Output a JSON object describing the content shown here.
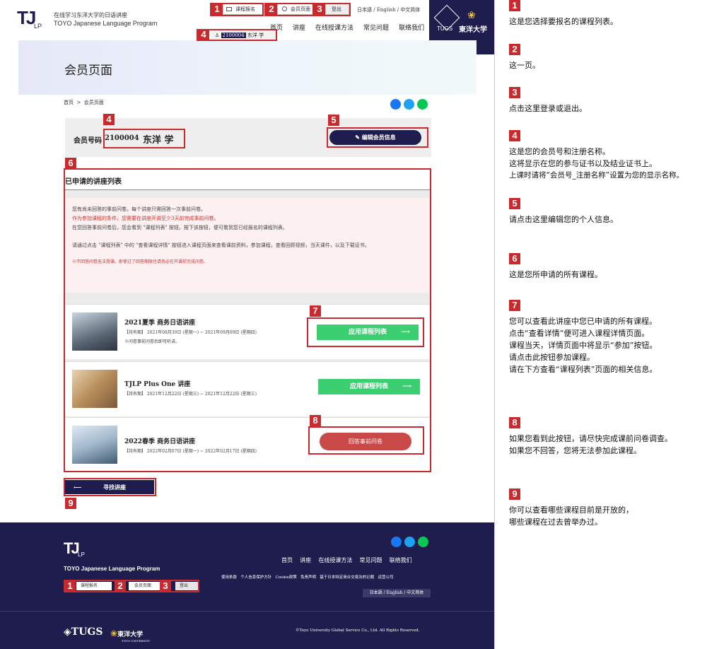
{
  "header": {
    "logo_tj": "TJ",
    "logo_lp": "LP",
    "tagline": "在线学习东洋大学的日语讲座",
    "program": "TOYO Japanese Language Program",
    "btn_apply": "课程报名",
    "btn_member": "会员页面",
    "btn_login": "登出",
    "langs": [
      "日本語",
      "English",
      "中文简体"
    ],
    "nav": [
      "首页",
      "讲座",
      "在线授课方法",
      "常见问题",
      "联络我们"
    ],
    "member_chip_id": "2100004",
    "member_chip_name": "东洋 学",
    "tugs": "TUGS",
    "toyo": "東洋大学"
  },
  "hero": {
    "title": "会员页面"
  },
  "breadcrumb": [
    "首页",
    "会员页面"
  ],
  "member": {
    "label": "会员号码",
    "id": "2100004",
    "name": "东洋 学",
    "edit": "编辑会员信息"
  },
  "list": {
    "title": "已申请的讲座列表",
    "notice": [
      "您有尚未回答的事前问卷。每个讲座只需回答一次事前问卷。",
      "作为参加课程的条件，您需要在讲座开讲至少3天前完成事前问卷。",
      "在您回答事前问卷后，您会看到 \"课程列表\" 按钮。按下该按钮，便可看到您已经报名的课程列表。",
      "请通过点击 \"课程列表\" 中的 \"查看课程详情\" 按钮进入课程页面来查看课前资料，参加课程，查看回顾视频，当天课件，以及下载证书。",
      "※不回答问卷无法授课。即使过了回答期限也请务必在开课前完成问卷。"
    ],
    "courses": [
      {
        "title": "2021夏季 商务日语讲座",
        "period": "【持有期】 2021年08月30日 (星期一) ~ 2021年09月09日 (星期四)",
        "note": "※问卷事前问卷后即可听讲。",
        "button": "应用课程列表"
      },
      {
        "title": "TJLP Plus One 讲座",
        "period": "【持有期】 2021年12月22日 (星期三) ~ 2021年12月22日 (星期三)",
        "note": "",
        "button": "应用课程列表"
      },
      {
        "title": "2022春季 商务日语讲座",
        "period": "【持有期】 2022年02月07日 (星期一) ~ 2022年02月17日 (星期四)",
        "note": "",
        "button": "回答事前问卷"
      }
    ],
    "find": "寻找讲座"
  },
  "footer": {
    "program": "TOYO Japanese Language Program",
    "nav": [
      "首页",
      "讲座",
      "在线授课方法",
      "常见问题",
      "联络我们"
    ],
    "links": [
      "使用条款",
      "个人信息保护方针",
      "Cookie政策",
      "免责声明",
      "基于日本特定商业交易法的记载",
      "运营公司"
    ],
    "langs": "日本語 / English / 中文简体",
    "tugs": "TUGS",
    "toyo": "東洋大学",
    "toyo_en": "TOYO UNIVERSITY",
    "copyright": "©Toyo University Global Service Co., Ltd. All Rights Reserved."
  },
  "notes": [
    {
      "n": "1",
      "lines": [
        "这是您选择要报名的课程列表。"
      ]
    },
    {
      "n": "2",
      "lines": [
        "这一页。"
      ]
    },
    {
      "n": "3",
      "lines": [
        "点击这里登录或退出。"
      ]
    },
    {
      "n": "4",
      "lines": [
        "这是您的会员号和注册名称。",
        "这将显示在您的参与证书以及结业证书上。",
        "上课时请将“会员号_注册名称”设置为您的显示名称。"
      ]
    },
    {
      "n": "5",
      "lines": [
        "请点击这里编辑您的个人信息。"
      ]
    },
    {
      "n": "6",
      "lines": [
        "这是您所申请的所有课程。"
      ]
    },
    {
      "n": "7",
      "lines": [
        "您可以查看此讲座中您已申请的所有课程。",
        "点击“查看详情”便可进入课程详情页面。",
        "课程当天，详情页面中将显示“参加”按钮。",
        "请点击此按钮参加课程。",
        "请在下方查看“课程列表”页面的相关信息。"
      ]
    },
    {
      "n": "8",
      "lines": [
        "如果您看到此按钮，请尽快完成课前问卷调查。",
        "如果您不回答，您将无法参加此课程。"
      ]
    },
    {
      "n": "9",
      "lines": [
        "你可以查看哪些课程目前是开放的，",
        "哪些课程在过去曾举办过。"
      ]
    }
  ],
  "tags": [
    "1",
    "2",
    "3",
    "4",
    "5",
    "6",
    "7",
    "8",
    "9"
  ],
  "colors": {
    "navy": "#1e1d4d",
    "green": "#3ccf72",
    "red": "#c92a2e",
    "annotation": "#c92a2e"
  }
}
